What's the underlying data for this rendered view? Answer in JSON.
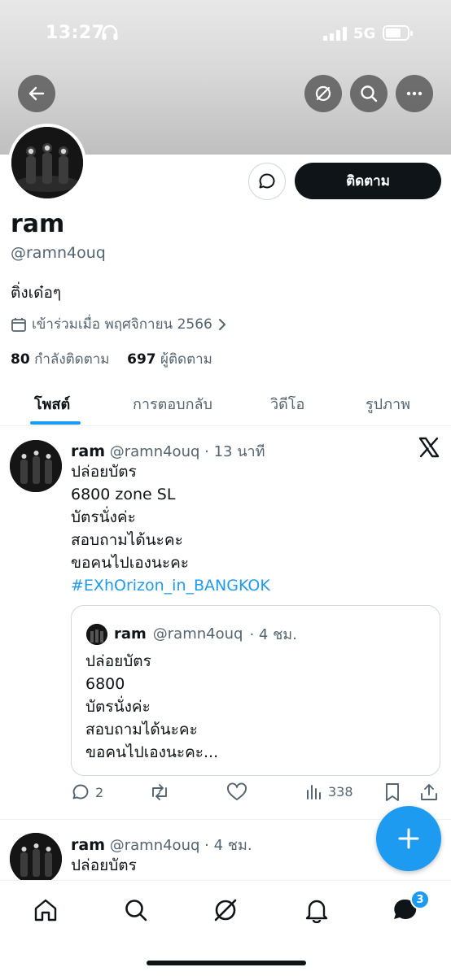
{
  "status_bar": {
    "time": "13:27",
    "network": "5G"
  },
  "profile": {
    "name": "ram",
    "handle": "@ramn4ouq",
    "bio": "ติ่งเด๋อๆ",
    "joined": "เข้าร่วมเมื่อ พฤศจิกายน 2566",
    "following_count": "80",
    "following_label": "กำลังติดตาม",
    "followers_count": "697",
    "followers_label": "ผู้ติดตาม",
    "follow_label": "ติดตาม"
  },
  "tabs": [
    {
      "label": "โพสต์"
    },
    {
      "label": "การตอบกลับ"
    },
    {
      "label": "วิดีโอ"
    },
    {
      "label": "รูปภาพ"
    }
  ],
  "tweet1": {
    "name": "ram",
    "handle": "@ramn4ouq",
    "time": "· 13 นาที",
    "lines": [
      "ปล่อยบัตร",
      "6800 zone SL",
      "บัตรนั่งค่ะ",
      "สอบถามได้นะคะ",
      "ขอคนไปเองนะคะ"
    ],
    "hashtag": "#EXhOrizon_in_BANGKOK",
    "quote": {
      "name": "ram",
      "handle": "@ramn4ouq",
      "time": "· 4 ชม.",
      "lines": [
        "ปล่อยบัตร",
        "6800",
        "บัตรนั่งค่ะ",
        "สอบถามได้นะคะ",
        "ขอคนไปเองนะคะ..."
      ]
    },
    "replies": "2",
    "views": "338"
  },
  "tweet2": {
    "name": "ram",
    "handle": "@ramn4ouq",
    "time": "· 4 ชม.",
    "line": "ปล่อยบัตร"
  },
  "nav": {
    "messages_badge": "3"
  },
  "colors": {
    "accent": "#1d9bf0",
    "text": "#0f1419",
    "muted": "#536471"
  }
}
